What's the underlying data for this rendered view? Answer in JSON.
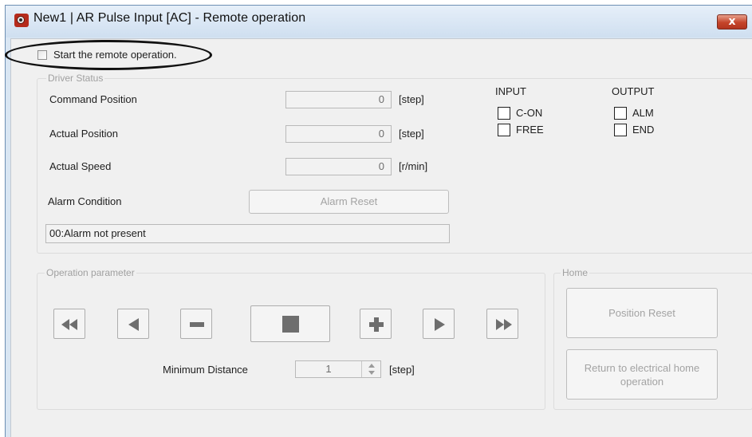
{
  "window": {
    "title": "New1 | AR Pulse Input [AC] - Remote operation",
    "close_glyph": "x"
  },
  "remote": {
    "label": "Start the remote operation.",
    "checked": false
  },
  "driver_status": {
    "group_title": "Driver Status",
    "command_position": {
      "label": "Command Position",
      "value": "0",
      "unit": "[step]"
    },
    "actual_position": {
      "label": "Actual Position",
      "value": "0",
      "unit": "[step]"
    },
    "actual_speed": {
      "label": "Actual Speed",
      "value": "0",
      "unit": "[r/min]"
    },
    "alarm_condition_label": "Alarm Condition",
    "alarm_reset_label": "Alarm Reset",
    "alarm_text": "00:Alarm not present",
    "input": {
      "header": "INPUT",
      "items": [
        "C-ON",
        "FREE"
      ]
    },
    "output": {
      "header": "OUTPUT",
      "items": [
        "ALM",
        "END"
      ]
    }
  },
  "operation": {
    "group_title": "Operation parameter",
    "min_distance_label": "Minimum Distance",
    "min_distance_value": "1",
    "min_distance_unit": "[step]",
    "jog_buttons": [
      "fast-reverse-icon",
      "reverse-icon",
      "minus-icon",
      "stop-icon",
      "plus-icon",
      "forward-icon",
      "fast-forward-icon"
    ]
  },
  "home": {
    "group_title": "Home",
    "position_reset_label": "Position Reset",
    "return_home_label": "Return to electrical home operation"
  },
  "colors": {
    "jog_icon": "#6e6e6e",
    "disabled_text": "#a0a0a0",
    "close_button": "#c4442a"
  }
}
